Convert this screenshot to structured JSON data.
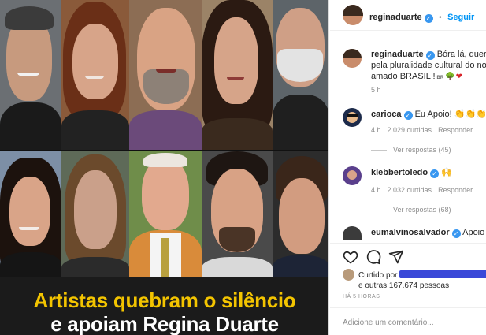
{
  "post": {
    "headline_line1": "Artistas quebram o silêncio",
    "headline_line2": "e apoiam Regina Duarte"
  },
  "header": {
    "username": "reginaduarte",
    "follow_label": "Seguir",
    "separator": "•"
  },
  "caption": {
    "username": "reginaduarte",
    "text_line1": "Bóra lá, querido",
    "text_line2": "pela pluralidade cultural do noss",
    "text_line3": "amado BRASIL !",
    "flag_badge": "BR",
    "time": "5 h"
  },
  "comments": [
    {
      "username": "carioca",
      "text": "Eu Apoio!",
      "time": "4 h",
      "likes": "2.029 curtidas",
      "reply_label": "Responder",
      "view_replies": "Ver respostas (45)"
    },
    {
      "username": "klebbertoledo",
      "text": "",
      "time": "4 h",
      "likes": "2.032 curtidas",
      "reply_label": "Responder",
      "view_replies": "Ver respostas (68)"
    },
    {
      "username": "eumalvinosalvador",
      "text": "Apoio"
    }
  ],
  "likes": {
    "prefix": "Curtido por",
    "suffix": "e outras 167.674 pessoas"
  },
  "timestamp": "HÁ 5 HORAS",
  "comment_box": {
    "placeholder": "Adicione um comentário..."
  },
  "icons": {
    "like": "heart-icon",
    "comment": "comment-icon",
    "share": "share-icon",
    "verified": "verified-badge-icon"
  },
  "colors": {
    "headline_yellow": "#f3c400",
    "link_blue": "#0095f6",
    "verified_blue": "#3897f0",
    "redaction_blue": "#3a48d8"
  }
}
